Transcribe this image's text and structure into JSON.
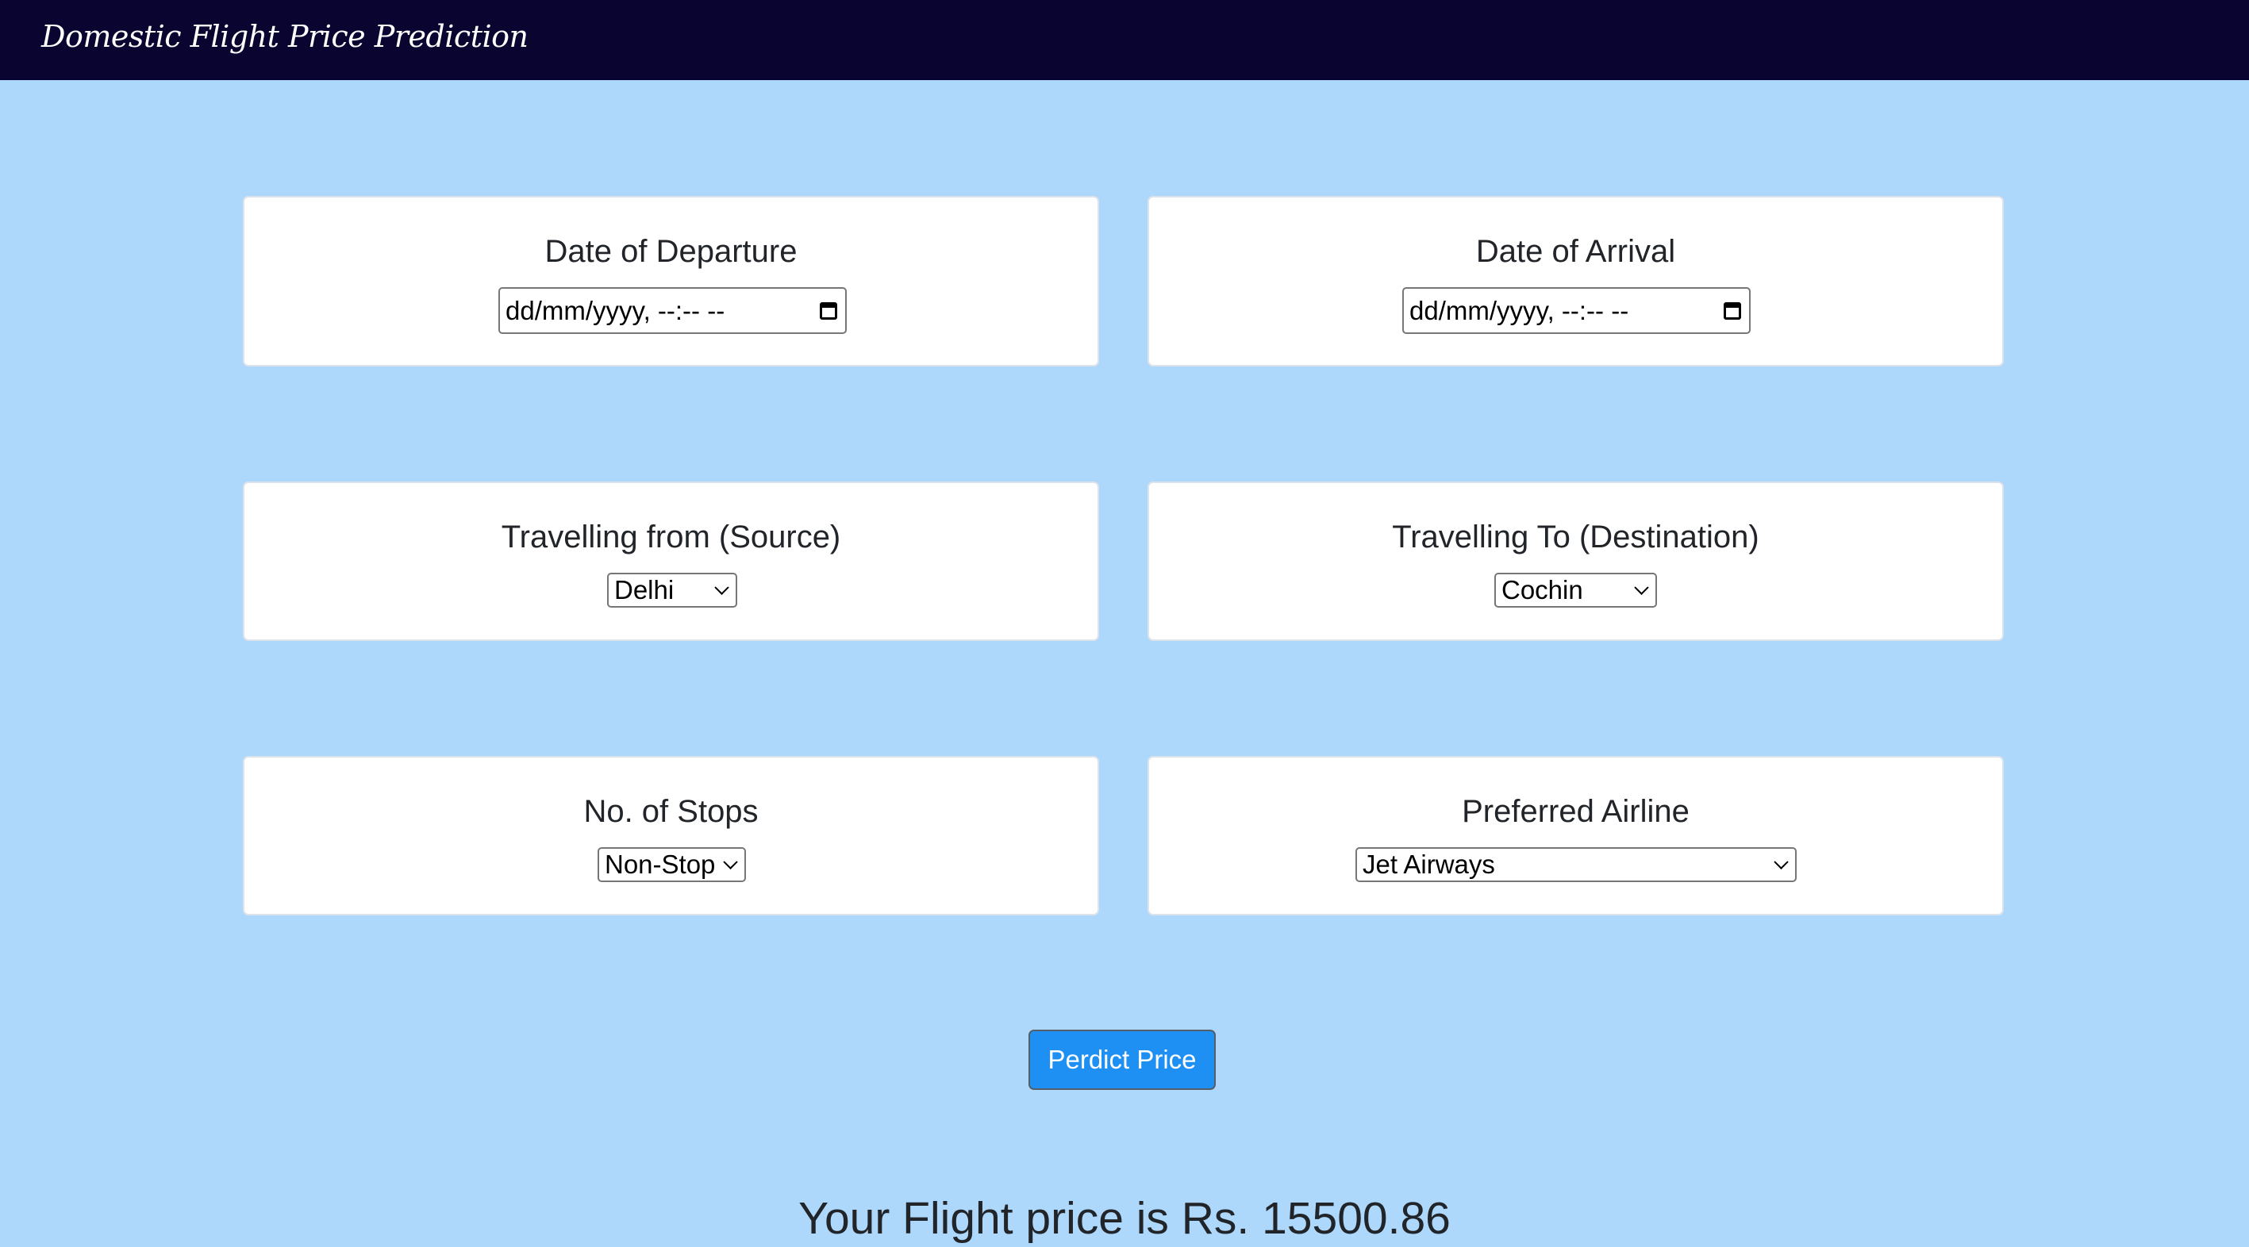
{
  "header": {
    "brand": "Domestic Flight Price Prediction"
  },
  "form": {
    "departure": {
      "label": "Date of Departure",
      "value": "dd/mm/yyyy, --:-- --"
    },
    "arrival": {
      "label": "Date of Arrival",
      "value": "dd/mm/yyyy, --:-- --"
    },
    "source": {
      "label": "Travelling from (Source)",
      "selected": "Delhi"
    },
    "destination": {
      "label": "Travelling To (Destination)",
      "selected": "Cochin"
    },
    "stops": {
      "label": "No. of Stops",
      "selected": "Non-Stop"
    },
    "airline": {
      "label": "Preferred Airline",
      "selected": "Jet Airways"
    },
    "submit_label": "Perdict Price"
  },
  "result": {
    "text": "Your Flight price is Rs. 15500.86"
  },
  "colors": {
    "page_background": "#add8fb",
    "navbar": "#0a0430",
    "button": "#1e8ff3"
  },
  "icons": {
    "date_picker": "calendar-icon",
    "select": "chevron-down-icon"
  }
}
